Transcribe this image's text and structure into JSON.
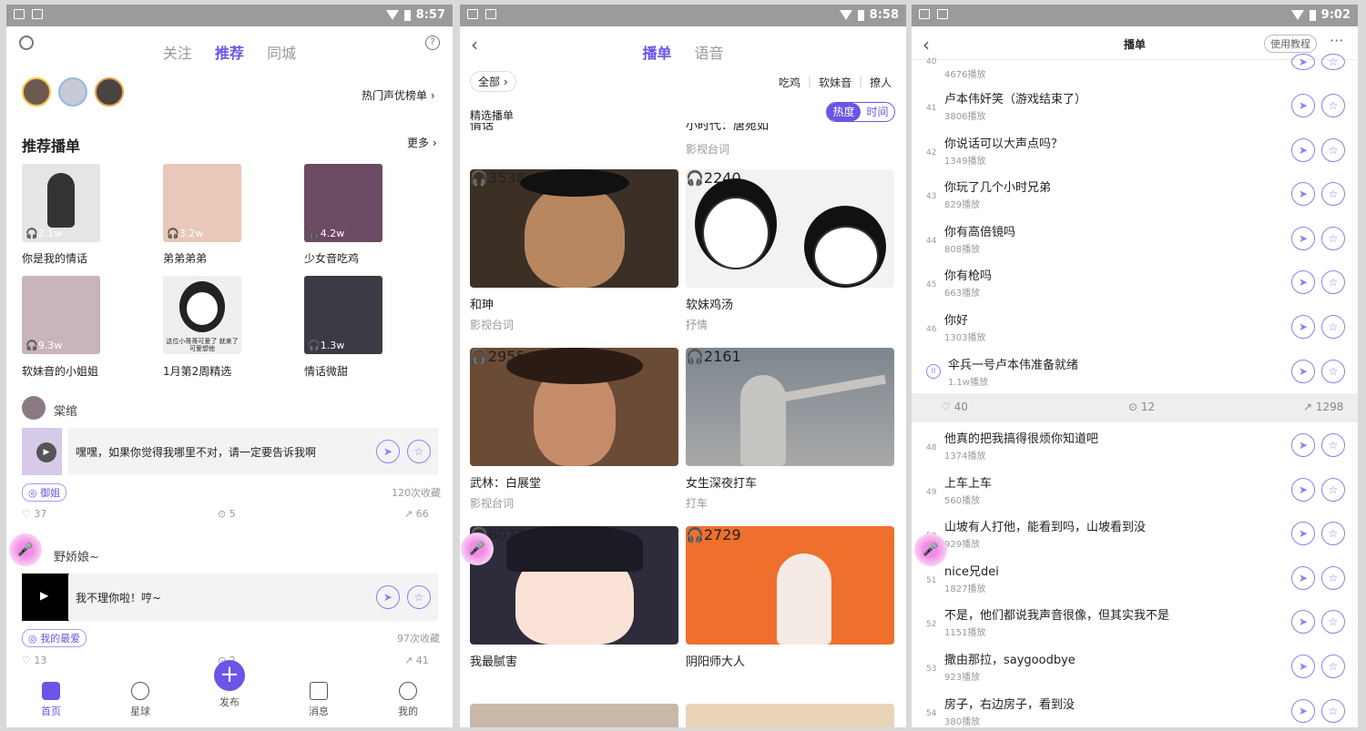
{
  "status": {
    "p1_time": "8:57",
    "p2_time": "8:58",
    "p3_time": "9:02"
  },
  "colors": {
    "accent": "#6a55e6",
    "mic": "#f38be6"
  },
  "p1": {
    "tabs": [
      "关注",
      "推荐",
      "同城"
    ],
    "hot_rank": "热门声优榜单",
    "section_title": "推荐播单",
    "more": "更多",
    "playlists": [
      {
        "count": "2.1w",
        "caption": "你是我的情话",
        "bg": "#e5e5e5"
      },
      {
        "count": "3.2w",
        "caption": "弟弟弟弟",
        "bg": "#e9c7b9"
      },
      {
        "count": "4.2w",
        "caption": "少女音吃鸡",
        "bg": "#6b4a63"
      },
      {
        "count": "9.3w",
        "caption": "软妹音的小姐姐",
        "bg": "#c9b3bc"
      },
      {
        "count": "",
        "caption": "1月第2周精选",
        "bg": "#efefef",
        "meme": "这位小哥哥可爱了 就来了可爱想他"
      },
      {
        "count": "1.3w",
        "caption": "情话微甜",
        "bg": "#3d3a46"
      }
    ],
    "posts": [
      {
        "user": "棠绾",
        "text": "嘿嘿，如果你觉得我哪里不对，请一定要告诉我啊",
        "tag": "御姐",
        "collect": "120次收藏",
        "likes": "37",
        "comments": "5",
        "shares": "66"
      },
      {
        "user": "野娇娘~",
        "text": "我不理你啦！哼~",
        "tag": "我的最爱",
        "collect": "97次收藏",
        "likes": "13",
        "comments": "2",
        "shares": "41"
      }
    ],
    "nav": [
      "首页",
      "星球",
      "发布",
      "消息",
      "我的"
    ]
  },
  "p2": {
    "tabs": [
      "播单",
      "语音"
    ],
    "filter": "全部",
    "chips": [
      "吃鸡",
      "软妹音",
      "撩人"
    ],
    "featured": "精选播单",
    "sort": [
      "热度",
      "时间"
    ],
    "top_partial_left": "情话",
    "top_partial_right": "小时代：唐宛如",
    "top_partial_sub": "影视台词",
    "cards": [
      {
        "count": "3538",
        "title": "和珅",
        "sub": "影视台词",
        "bg": "#3c3026"
      },
      {
        "count": "2240",
        "title": "软妹鸡汤",
        "sub": "抒情",
        "bg": "#f2f2f2"
      },
      {
        "count": "2955",
        "title": "武林：白展堂",
        "sub": "影视台词",
        "bg": "#6a4b36"
      },
      {
        "count": "2161",
        "title": "女生深夜打车",
        "sub": "打车",
        "bg": "#8e9aa5"
      },
      {
        "count": "6077",
        "title": "我最腻害",
        "sub": "",
        "bg": "#2e2b3b"
      },
      {
        "count": "2729",
        "title": "阴阳师大人",
        "sub": "",
        "bg": "#ef6f2d"
      }
    ]
  },
  "p3": {
    "title": "播单",
    "tutorial": "使用教程",
    "top_count": "4676播放",
    "rows": [
      {
        "n": "41",
        "t": "卢本伟奸笑（游戏结束了）",
        "p": "3806播放"
      },
      {
        "n": "42",
        "t": "你说话可以大声点吗？",
        "p": "1349播放"
      },
      {
        "n": "43",
        "t": "你玩了几个小时兄弟",
        "p": "829播放"
      },
      {
        "n": "44",
        "t": "你有高倍镜吗",
        "p": "808播放"
      },
      {
        "n": "45",
        "t": "你有枪吗",
        "p": "663播放"
      },
      {
        "n": "46",
        "t": "你好",
        "p": "1303播放"
      }
    ],
    "playing": {
      "t": "伞兵一号卢本伟准备就绪",
      "p": "1.1w播放"
    },
    "stats": {
      "likes": "40",
      "comments": "12",
      "shares": "1298"
    },
    "rows2": [
      {
        "n": "48",
        "t": "他真的把我搞得很烦你知道吧",
        "p": "1374播放"
      },
      {
        "n": "49",
        "t": "上车上车",
        "p": "560播放"
      },
      {
        "n": "50",
        "t": "山坡有人打他，能看到吗，山坡看到没",
        "p": "929播放"
      },
      {
        "n": "51",
        "t": "nice兄dei",
        "p": "1827播放"
      },
      {
        "n": "52",
        "t": "不是，他们都说我声音很像，但其实我不是",
        "p": "1151播放"
      },
      {
        "n": "53",
        "t": "撒由那拉，saygoodbye",
        "p": "923播放"
      },
      {
        "n": "54",
        "t": "房子，右边房子，看到没",
        "p": "380播放"
      }
    ]
  }
}
